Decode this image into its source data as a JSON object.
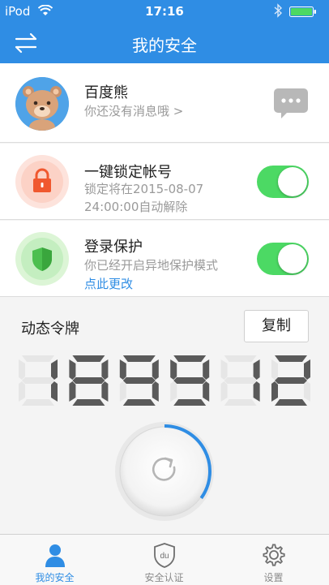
{
  "status_bar": {
    "carrier": "iPod",
    "time": "17:16"
  },
  "nav": {
    "title": "我的安全"
  },
  "profile": {
    "name": "百度熊",
    "message": "你还没有消息哦 >"
  },
  "lock_account": {
    "title": "一键锁定帐号",
    "desc_line1": "锁定将在2015-08-07",
    "desc_line2": "24:00:00自动解除",
    "enabled": true
  },
  "login_protect": {
    "title": "登录保护",
    "desc": "你已经开启异地保护模式",
    "link": "点此更改",
    "enabled": true
  },
  "token": {
    "title": "动态令牌",
    "copy_label": "复制",
    "code": "189912",
    "refresh_progress": 0.35
  },
  "tabs": [
    {
      "label": "我的安全",
      "icon": "person-icon",
      "active": true
    },
    {
      "label": "安全认证",
      "icon": "du-shield-icon",
      "active": false
    },
    {
      "label": "设置",
      "icon": "gear-icon",
      "active": false
    }
  ],
  "colors": {
    "primary": "#2f8de4",
    "toggle_on": "#4cd964",
    "digit_on": "#5a5a5a",
    "digit_off": "#e6e6e6"
  }
}
